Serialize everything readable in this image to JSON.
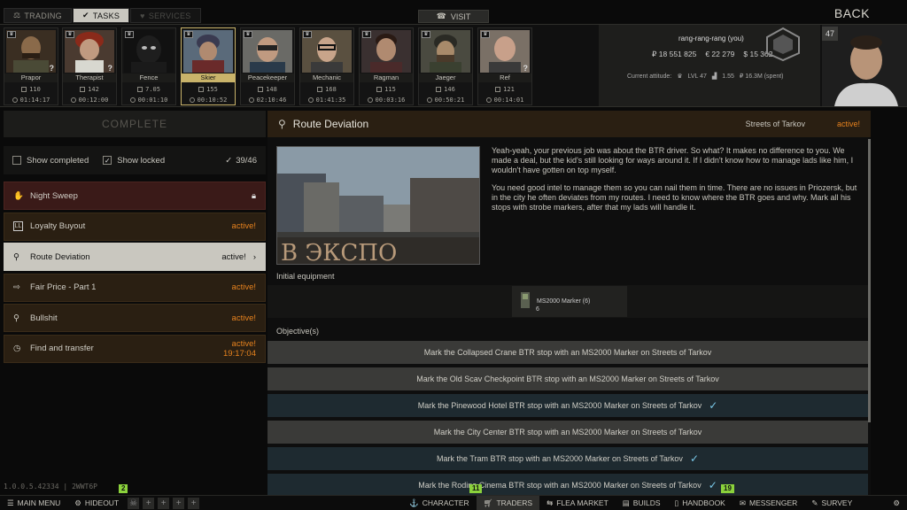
{
  "top_tabs": [
    {
      "label": "TRADING",
      "state": "normal"
    },
    {
      "label": "TASKS",
      "state": "active"
    },
    {
      "label": "SERVICES",
      "state": "disabled"
    }
  ],
  "visit_label": "VISIT",
  "back_label": "BACK",
  "traders": [
    {
      "name": "Prapor",
      "level": "110",
      "timer": "01:14:17"
    },
    {
      "name": "Therapist",
      "level": "142",
      "timer": "00:12:00"
    },
    {
      "name": "Fence",
      "level": "7.05",
      "timer": "00:01:10"
    },
    {
      "name": "Skier",
      "level": "155",
      "timer": "00:10:52"
    },
    {
      "name": "Peacekeeper",
      "level": "148",
      "timer": "02:10:46"
    },
    {
      "name": "Mechanic",
      "level": "168",
      "timer": "01:41:35"
    },
    {
      "name": "Ragman",
      "level": "115",
      "timer": "00:03:16"
    },
    {
      "name": "Jaeger",
      "level": "146",
      "timer": "00:50:21"
    },
    {
      "name": "Ref",
      "level": "121",
      "timer": "00:14:01"
    }
  ],
  "player": {
    "name": "rang-rang-rang (you)",
    "rubles": "₽ 18 551 825",
    "euros": "€ 22 279",
    "dollars": "$ 15 362",
    "attitude_label": "Current attitude:",
    "loyalty_level": "LVL 47",
    "standing": "1.55",
    "spent": "₽ 16.3M (spent)",
    "level": "47"
  },
  "left": {
    "complete_label": "COMPLETE",
    "show_completed": "Show completed",
    "show_locked": "Show locked",
    "quest_count": "39/46",
    "quests": [
      {
        "name": "Night Sweep",
        "status": "",
        "icon": "key-icon"
      },
      {
        "name": "Loyalty Buyout",
        "status": "active!",
        "icon": "trader-ll-icon"
      },
      {
        "name": "Route Deviation",
        "status": "active!",
        "icon": "location-pin-icon"
      },
      {
        "name": "Fair Price - Part 1",
        "status": "active!",
        "icon": "exit-icon"
      },
      {
        "name": "Bullshit",
        "status": "active!",
        "icon": "location-pin-icon"
      },
      {
        "name": "Find and transfer",
        "status": "active!",
        "timer": "19:17:04",
        "icon": "clock-icon"
      }
    ]
  },
  "detail": {
    "title": "Route Deviation",
    "location": "Streets of Tarkov",
    "status": "active!",
    "image_sign": "В ЭКСПО",
    "description_1": "Yeah-yeah, your previous job was about the BTR driver. So what? It makes no difference to you. We made a deal, but the kid's still looking for ways around it. If I didn't know how to manage lads like him, I wouldn't have gotten on top myself.",
    "description_2": "You need good intel to manage them so you can nail them in time. There are no issues in Priozersk, but in the city he often deviates from my routes. I need to know where the BTR goes and why. Mark all his stops with strobe markers, after that my lads will handle it.",
    "equipment_label": "Initial equipment",
    "equipment_item": "MS2000 Marker (6)",
    "equipment_count": "6",
    "objectives_label": "Objective(s)",
    "objectives": [
      {
        "text": "Mark the Collapsed Crane BTR stop with an MS2000 Marker on Streets of Tarkov",
        "done": false
      },
      {
        "text": "Mark the Old Scav Checkpoint BTR stop with an MS2000 Marker on Streets of Tarkov",
        "done": false
      },
      {
        "text": "Mark the Pinewood Hotel BTR stop with an MS2000 Marker on Streets of Tarkov",
        "done": true
      },
      {
        "text": "Mark the City Center BTR stop with an MS2000 Marker on Streets of Tarkov",
        "done": false
      },
      {
        "text": "Mark the Tram BTR stop with an MS2000 Marker on Streets of Tarkov",
        "done": true
      },
      {
        "text": "Mark the Rodina Cinema BTR stop with an MS2000 Marker on Streets of Tarkov",
        "done": true
      }
    ]
  },
  "version": "1.0.0.5.42334 | 2WWT6P",
  "badges": {
    "hideout": "2",
    "traders": "11",
    "handbook": "19"
  },
  "bottom_bar": [
    {
      "label": "MAIN MENU",
      "icon": "menu-icon"
    },
    {
      "label": "HIDEOUT",
      "icon": "hideout-icon"
    },
    {
      "label": "CHARACTER",
      "icon": "character-icon"
    },
    {
      "label": "TRADERS",
      "icon": "cart-icon"
    },
    {
      "label": "FLEA MARKET",
      "icon": "flea-icon"
    },
    {
      "label": "BUILDS",
      "icon": "builds-icon"
    },
    {
      "label": "HANDBOOK",
      "icon": "handbook-icon"
    },
    {
      "label": "MESSENGER",
      "icon": "messenger-icon"
    },
    {
      "label": "SURVEY",
      "icon": "survey-icon"
    }
  ],
  "colors": {
    "active_orange": "#e6821e",
    "selected": "#c9c7bf",
    "accent_gold": "#c9b36a",
    "tick_blue": "#7ac8e8",
    "badge_green": "#8bd23c"
  }
}
